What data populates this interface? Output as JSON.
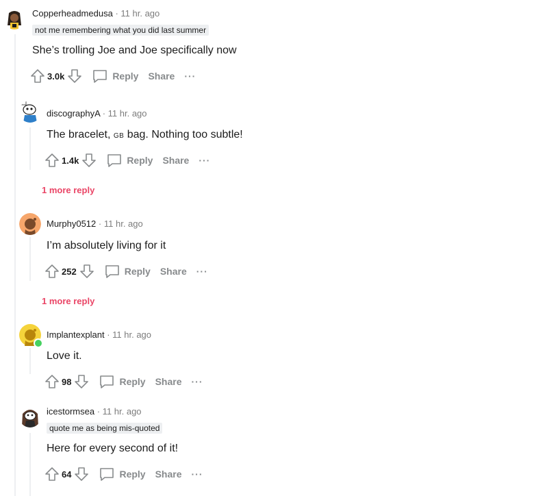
{
  "comments": [
    {
      "username": "Copperheadmedusa",
      "time": "11 hr. ago",
      "flair": "not me remembering what you did last summer",
      "body": "She’s trolling Joe and Joe specifically now",
      "score": "3.0k"
    },
    {
      "username": "discographyA",
      "time": "11 hr. ago",
      "body_pre": "The bracelet, ",
      "body_small": "GB",
      "body_post": " bag. Nothing too subtle!",
      "score": "1.4k",
      "more_replies": "1 more reply"
    },
    {
      "username": "Murphy0512",
      "time": "11 hr. ago",
      "body": "I’m absolutely living for it",
      "score": "252",
      "more_replies": "1 more reply"
    },
    {
      "username": "Implantexplant",
      "time": "11 hr. ago",
      "body": "Love it.",
      "score": "98"
    },
    {
      "username": "icestormsea",
      "time": "11 hr. ago",
      "flair": "quote me as being mis-quoted",
      "body": "Here for every second of it!",
      "score": "64"
    }
  ],
  "labels": {
    "reply": "Reply",
    "share": "Share",
    "separator": "·",
    "more": "···"
  },
  "colors": {
    "more_replies": "#ea4566",
    "muted": "#878a8c",
    "thread_line": "#edeff1"
  }
}
